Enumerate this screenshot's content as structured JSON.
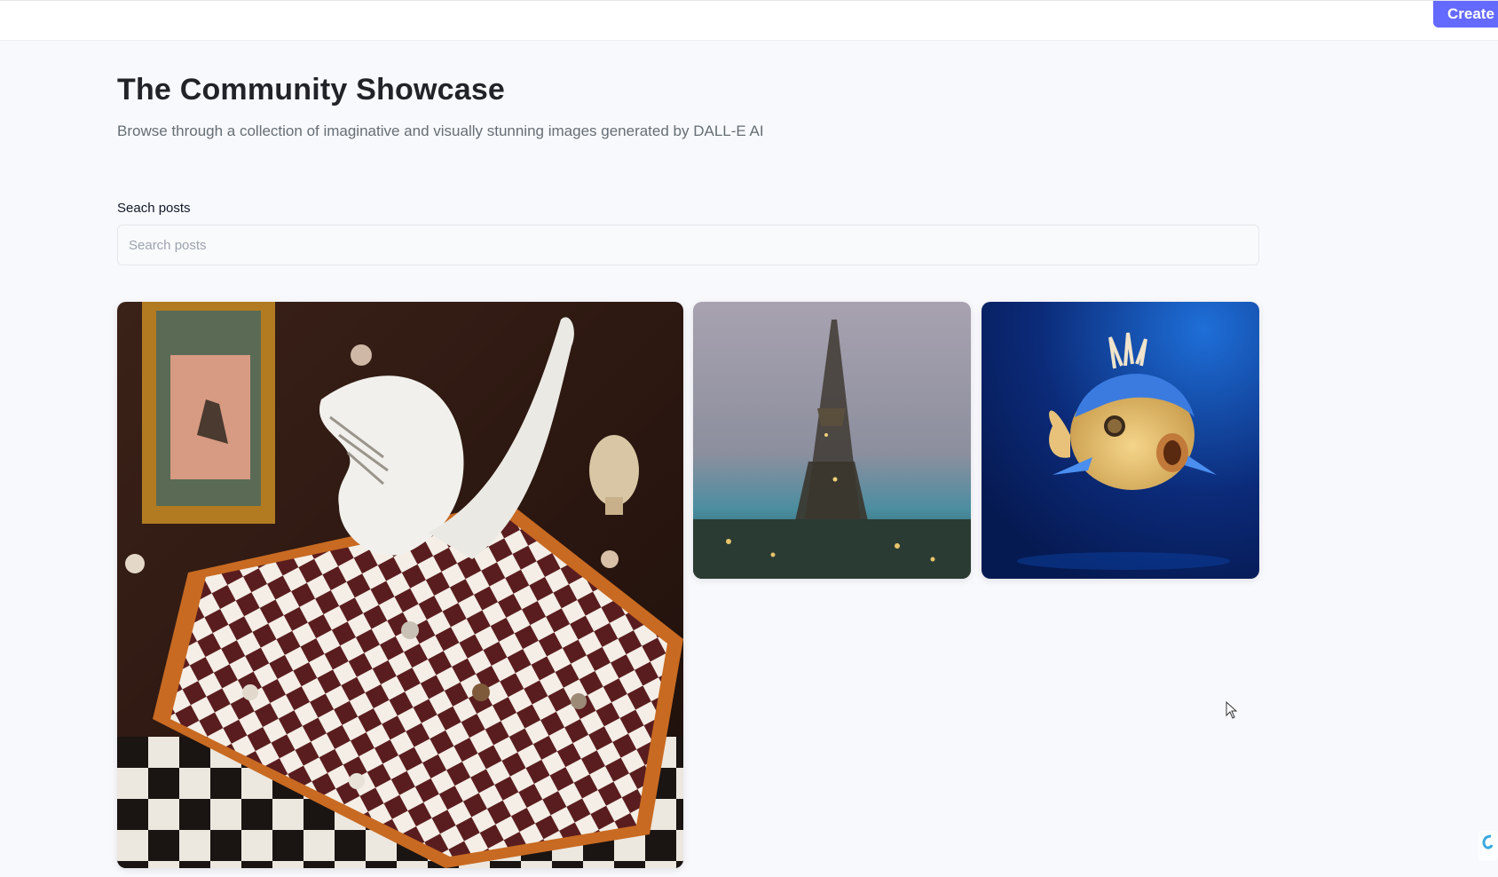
{
  "header": {
    "create_label": "Create"
  },
  "main": {
    "title": "The Community Showcase",
    "subtitle": "Browse through a collection of imaginative and visually stunning images generated by DALL-E AI"
  },
  "search": {
    "label": "Seach posts",
    "placeholder": "Search posts",
    "value": ""
  },
  "gallery": {
    "posts": [
      {
        "image": "cat-playing-chess-painting"
      },
      {
        "image": "eiffel-tower-impressionist-painting"
      },
      {
        "image": "3d-blue-pufferfish"
      }
    ]
  },
  "colors": {
    "accent": "#6469ff",
    "background": "#f8f9fc",
    "title": "#222328",
    "subtitle": "#666e75"
  }
}
